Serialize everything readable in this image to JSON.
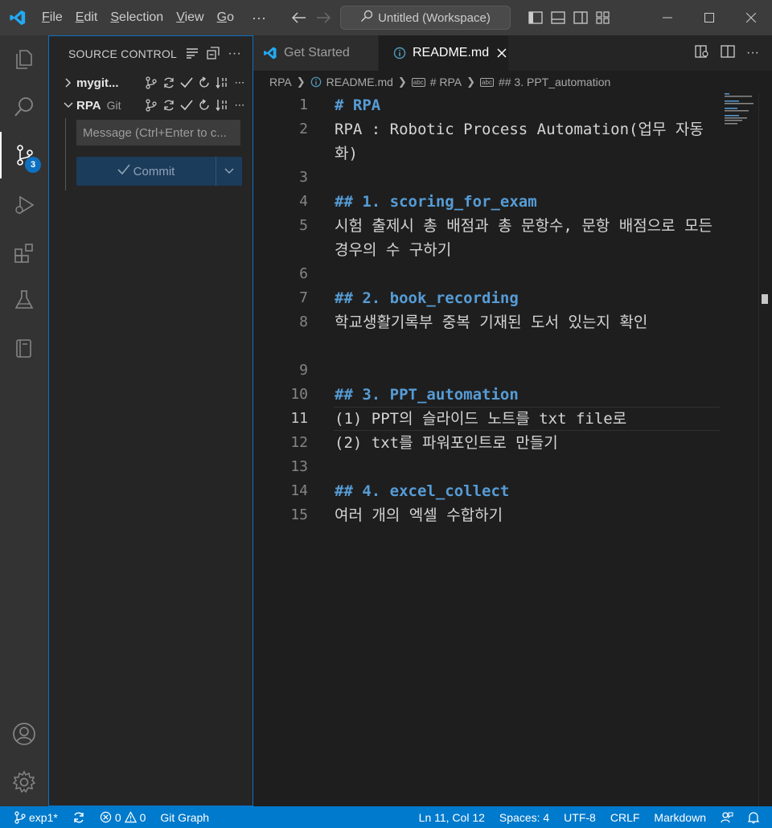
{
  "titlebar": {
    "menu": [
      "File",
      "Edit",
      "Selection",
      "View",
      "Go"
    ],
    "more": "···",
    "search_text": "Untitled (Workspace)"
  },
  "activitybar": {
    "items": [
      "explorer-icon",
      "search-icon",
      "source-control-icon",
      "run-debug-icon",
      "extensions-icon",
      "testing-icon",
      "remote-explorer-icon"
    ],
    "scm_badge": "3",
    "bottom": [
      "account-icon",
      "settings-gear-icon"
    ]
  },
  "sidebar": {
    "title": "SOURCE CONTROL",
    "repos": [
      {
        "name": "mygit...",
        "kind": "",
        "expanded": false
      },
      {
        "name": "RPA",
        "kind": "Git",
        "expanded": true
      }
    ],
    "message_placeholder": "Message (Ctrl+Enter to c...",
    "commit_label": "Commit"
  },
  "tabs": [
    {
      "label": "Get Started",
      "active": false
    },
    {
      "label": "README.md",
      "active": true
    }
  ],
  "breadcrumb": [
    "RPA",
    "README.md",
    "# RPA",
    "## 3. PPT_automation"
  ],
  "editor": {
    "current_line": 11,
    "lines": [
      {
        "n": "1",
        "text": "# RPA",
        "head": true
      },
      {
        "n": "2",
        "text": "RPA : Robotic Process Automation(업무 자동화)",
        "head": false
      },
      {
        "n": "3",
        "text": "",
        "head": false
      },
      {
        "n": "4",
        "text": "## 1. scoring_for_exam",
        "head": true
      },
      {
        "n": "5",
        "text": "시험 출제시 총 배점과 총 문항수, 문항 배점으로 모든 경우의 수 구하기",
        "head": false
      },
      {
        "n": "6",
        "text": "",
        "head": false
      },
      {
        "n": "7",
        "text": "## 2. book_recording",
        "head": true
      },
      {
        "n": "8",
        "text": "학교생활기록부 중복 기재된 도서 있는지 확인",
        "head": false
      },
      {
        "n": "9",
        "text": "",
        "head": false
      },
      {
        "n": "10",
        "text": "## 3. PPT_automation",
        "head": true
      },
      {
        "n": "11",
        "text": "(1) PPT의 슬라이드 노트를 txt file로",
        "head": false
      },
      {
        "n": "12",
        "text": "(2) txt를 파워포인트로 만들기",
        "head": false
      },
      {
        "n": "13",
        "text": "",
        "head": false
      },
      {
        "n": "14",
        "text": "## 4. excel_collect",
        "head": true
      },
      {
        "n": "15",
        "text": "여러 개의 엑셀 수합하기",
        "head": false
      }
    ]
  },
  "statusbar": {
    "branch": "exp1*",
    "errors": "0",
    "warnings": "0",
    "git_graph": "Git Graph",
    "position": "Ln 11, Col 12",
    "spaces": "Spaces: 4",
    "encoding": "UTF-8",
    "eol": "CRLF",
    "language": "Markdown"
  }
}
